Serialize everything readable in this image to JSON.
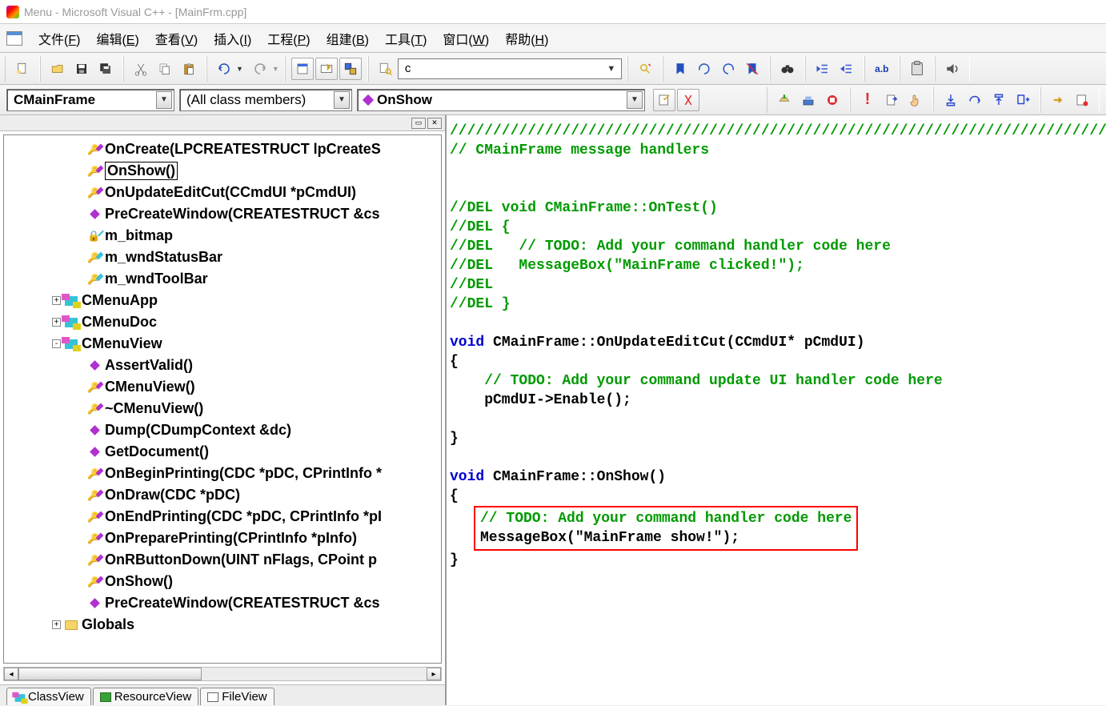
{
  "title": "Menu - Microsoft Visual C++ - [MainFrm.cpp]",
  "menubar": [
    {
      "label": "文件",
      "accel": "F"
    },
    {
      "label": "编辑",
      "accel": "E"
    },
    {
      "label": "查看",
      "accel": "V"
    },
    {
      "label": "插入",
      "accel": "I"
    },
    {
      "label": "工程",
      "accel": "P"
    },
    {
      "label": "组建",
      "accel": "B"
    },
    {
      "label": "工具",
      "accel": "T"
    },
    {
      "label": "窗口",
      "accel": "W"
    },
    {
      "label": "帮助",
      "accel": "H"
    }
  ],
  "toolbar": {
    "search_value": "c",
    "ab_label": "a.b"
  },
  "nav": {
    "class_combo": "CMainFrame",
    "filter_combo": "(All class members)",
    "member_combo": "OnShow"
  },
  "tree": [
    {
      "depth": 3,
      "kind": "method-key",
      "label": "OnCreate(LPCREATESTRUCT lpCreateS"
    },
    {
      "depth": 3,
      "kind": "method-key",
      "label": "OnShow()",
      "selected": true
    },
    {
      "depth": 3,
      "kind": "method-key",
      "label": "OnUpdateEditCut(CCmdUI *pCmdUI)"
    },
    {
      "depth": 3,
      "kind": "method",
      "label": "PreCreateWindow(CREATESTRUCT &cs"
    },
    {
      "depth": 3,
      "kind": "member-lock",
      "label": "m_bitmap"
    },
    {
      "depth": 3,
      "kind": "member-key",
      "label": "m_wndStatusBar"
    },
    {
      "depth": 3,
      "kind": "member-key",
      "label": "m_wndToolBar"
    },
    {
      "depth": 2,
      "kind": "class",
      "expander": "+",
      "label": "CMenuApp"
    },
    {
      "depth": 2,
      "kind": "class",
      "expander": "+",
      "label": "CMenuDoc"
    },
    {
      "depth": 2,
      "kind": "class",
      "expander": "-",
      "label": "CMenuView"
    },
    {
      "depth": 3,
      "kind": "method",
      "label": "AssertValid()"
    },
    {
      "depth": 3,
      "kind": "method-key",
      "label": "CMenuView()"
    },
    {
      "depth": 3,
      "kind": "method-key",
      "label": "~CMenuView()"
    },
    {
      "depth": 3,
      "kind": "method",
      "label": "Dump(CDumpContext &dc)"
    },
    {
      "depth": 3,
      "kind": "method",
      "label": "GetDocument()"
    },
    {
      "depth": 3,
      "kind": "method-key",
      "label": "OnBeginPrinting(CDC *pDC, CPrintInfo *"
    },
    {
      "depth": 3,
      "kind": "method-key",
      "label": "OnDraw(CDC *pDC)"
    },
    {
      "depth": 3,
      "kind": "method-key",
      "label": "OnEndPrinting(CDC *pDC, CPrintInfo *pI"
    },
    {
      "depth": 3,
      "kind": "method-key",
      "label": "OnPreparePrinting(CPrintInfo *pInfo)"
    },
    {
      "depth": 3,
      "kind": "method-key",
      "label": "OnRButtonDown(UINT nFlags, CPoint p"
    },
    {
      "depth": 3,
      "kind": "method-key",
      "label": "OnShow()"
    },
    {
      "depth": 3,
      "kind": "method",
      "label": "PreCreateWindow(CREATESTRUCT &cs"
    },
    {
      "depth": 2,
      "kind": "folder",
      "expander": "+",
      "label": "Globals"
    }
  ],
  "bottom_tabs": {
    "classview": "ClassView",
    "resourceview": "ResourceView",
    "fileview": "FileView"
  },
  "code": {
    "l1": "/////////////////////////////////////////////////////////////////////////////",
    "l2": "// CMainFrame message handlers",
    "l3": "//DEL void CMainFrame::OnTest()",
    "l4": "//DEL {",
    "l5": "//DEL   // TODO: Add your command handler code here",
    "l6": "//DEL   MessageBox(\"MainFrame clicked!\");",
    "l7": "//DEL",
    "l8": "//DEL }",
    "sig2_kw": "void",
    "sig2_rest": " CMainFrame::OnUpdateEditCut(CCmdUI* pCmdUI)",
    "brace_open": "{",
    "todo2": "    // TODO: Add your command update UI handler code here",
    "body2": "    pCmdUI->Enable();",
    "brace_close": "}",
    "sig3_kw": "void",
    "sig3_rest": " CMainFrame::OnShow()",
    "todo3": "// TODO: Add your command handler code here",
    "body3": "MessageBox(\"MainFrame show!\");"
  }
}
